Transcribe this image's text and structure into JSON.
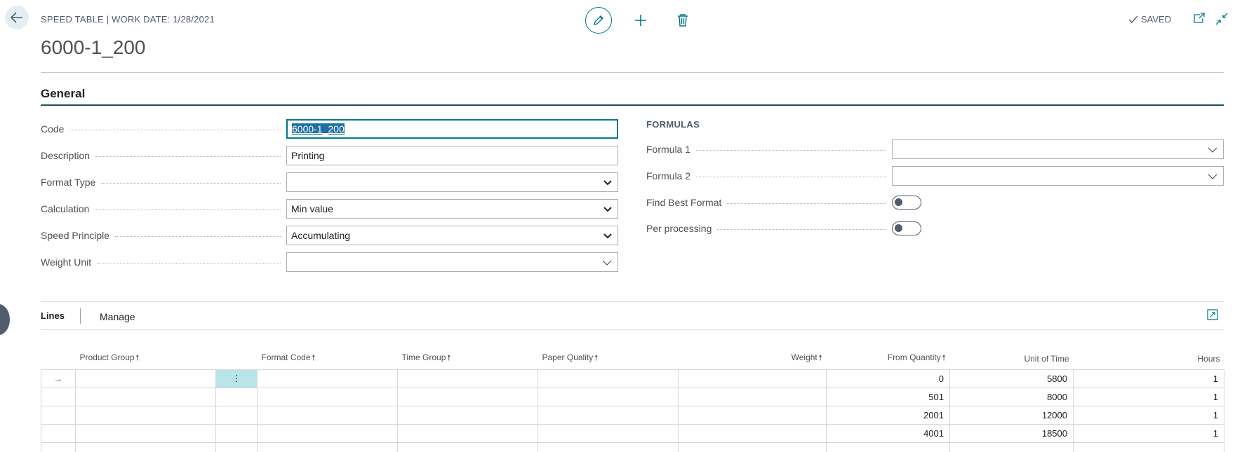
{
  "header": {
    "caption": "SPEED TABLE | WORK DATE: 1/28/2021",
    "title": "6000-1_200",
    "status": "SAVED"
  },
  "general": {
    "section_title": "General",
    "fields": {
      "code": {
        "label": "Code",
        "value": "6000-1_200"
      },
      "description": {
        "label": "Description",
        "value": "Printing"
      },
      "format_type": {
        "label": "Format Type",
        "value": ""
      },
      "calculation": {
        "label": "Calculation",
        "value": "Min value"
      },
      "speed_principle": {
        "label": "Speed Principle",
        "value": "Accumulating"
      },
      "weight_unit": {
        "label": "Weight Unit",
        "value": ""
      }
    },
    "formulas": {
      "header": "FORMULAS",
      "formula1": {
        "label": "Formula 1",
        "value": ""
      },
      "formula2": {
        "label": "Formula 2",
        "value": ""
      },
      "find_best_format": {
        "label": "Find Best Format",
        "on": false
      },
      "per_processing": {
        "label": "Per processing",
        "on": false
      }
    }
  },
  "lines": {
    "tabs": [
      "Lines",
      "Manage"
    ],
    "columns": {
      "product_group": "Product Group",
      "format_code": "Format Code",
      "time_group": "Time Group",
      "paper_quality": "Paper Quality",
      "weight": "Weight",
      "from_quantity": "From Quantity",
      "unit_of_time": "Unit of Time",
      "hours": "Hours"
    },
    "rows": [
      {
        "from_quantity": "0",
        "unit_of_time": "5800",
        "hours": "1"
      },
      {
        "from_quantity": "501",
        "unit_of_time": "8000",
        "hours": "1"
      },
      {
        "from_quantity": "2001",
        "unit_of_time": "12000",
        "hours": "1"
      },
      {
        "from_quantity": "4001",
        "unit_of_time": "18500",
        "hours": "1"
      }
    ]
  },
  "colors": {
    "accent": "#00788a",
    "selection": "#1d6fa5",
    "row_menu": "#b9e4ea"
  }
}
